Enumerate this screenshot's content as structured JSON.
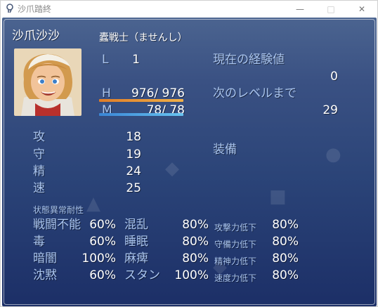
{
  "window": {
    "title": "沙爪踏終",
    "icon": "app-icon",
    "controls": {
      "minimize": "—",
      "maximize": "□",
      "close": "✕"
    }
  },
  "actor": {
    "name": "沙爪沙沙",
    "class": "蠹戦士（ませんし）",
    "level_label": "L",
    "level": "1",
    "hp_label": "H",
    "hp": "976/ 976",
    "hp_ratio": 1.0,
    "mp_label": "M",
    "mp": "78/  78",
    "mp_ratio": 1.0
  },
  "exp": {
    "current_label": "現在の経験値",
    "current_value": "0",
    "next_label": "次のレベルまで",
    "next_value": "29"
  },
  "equipment_label": "装備",
  "params": [
    {
      "label": "攻",
      "value": "18"
    },
    {
      "label": "守",
      "value": "19"
    },
    {
      "label": "精",
      "value": "24"
    },
    {
      "label": "速",
      "value": "25"
    }
  ],
  "resist": {
    "header": "状態異常耐性",
    "rows": [
      [
        {
          "label": "戦闘不能",
          "value": "60%"
        },
        {
          "label": "混乱",
          "value": "80%"
        },
        {
          "label": "攻撃力低下",
          "value": "80%"
        }
      ],
      [
        {
          "label": "毒",
          "value": "60%"
        },
        {
          "label": "睡眠",
          "value": "80%"
        },
        {
          "label": "守備力低下",
          "value": "80%"
        }
      ],
      [
        {
          "label": "暗闇",
          "value": "100%"
        },
        {
          "label": "麻痺",
          "value": "80%"
        },
        {
          "label": "精神力低下",
          "value": "80%"
        }
      ],
      [
        {
          "label": "沈黙",
          "value": "60%"
        },
        {
          "label": "スタン",
          "value": "100%"
        },
        {
          "label": "速度力低下",
          "value": "80%"
        }
      ]
    ]
  },
  "colors": {
    "window_bg_top": "#4b6490",
    "window_bg_bottom": "#1c2f67",
    "system_text": "#a9c4ee",
    "hp_gauge": "#f0b048",
    "mp_gauge": "#68c3f0"
  }
}
